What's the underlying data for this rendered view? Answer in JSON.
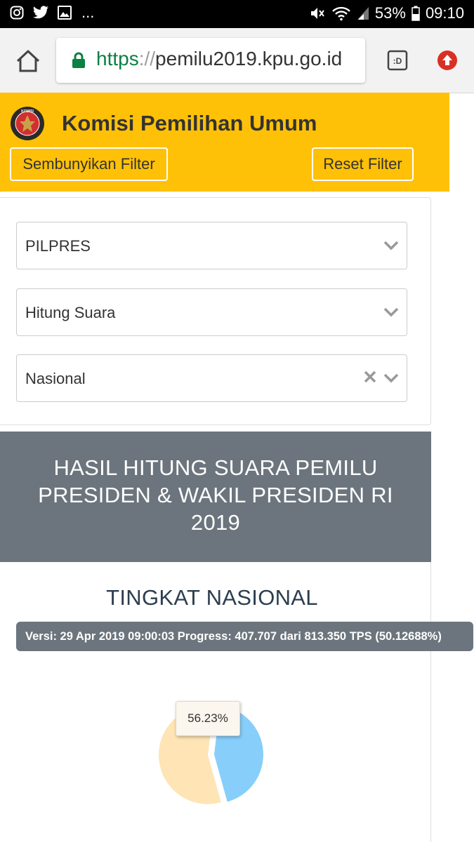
{
  "status_bar": {
    "battery": "53%",
    "time": "09:10",
    "overflow": "..."
  },
  "browser": {
    "url_scheme": "https",
    "url_sep": "://",
    "url_host": "pemilu2019.kpu.go.id"
  },
  "header": {
    "title": "Komisi Pemilihan Umum",
    "logo_text": "KOMISI",
    "hide_filter_label": "Sembunyikan Filter",
    "reset_filter_label": "Reset Filter"
  },
  "filters": {
    "election": "PILPRES",
    "mode": "Hitung Suara",
    "region": "Nasional"
  },
  "result": {
    "banner_title": "HASIL HITUNG SUARA PEMILU PRESIDEN & WAKIL PRESIDEN RI 2019",
    "level_title": "TINGKAT NASIONAL",
    "version_info": "Versi: 29 Apr 2019 09:00:03 Progress: 407.707 dari 813.350 TPS (50.12688%)"
  },
  "chart_data": {
    "type": "pie",
    "slices": [
      {
        "value": 56.23,
        "color": "#ffe4b5"
      },
      {
        "value": 43.77,
        "color": "#87cefa"
      }
    ],
    "tooltip": "56.23%"
  },
  "colors": {
    "brand_yellow": "#ffc107",
    "banner_gray": "#6c757d",
    "lock_green": "#0b8043"
  }
}
